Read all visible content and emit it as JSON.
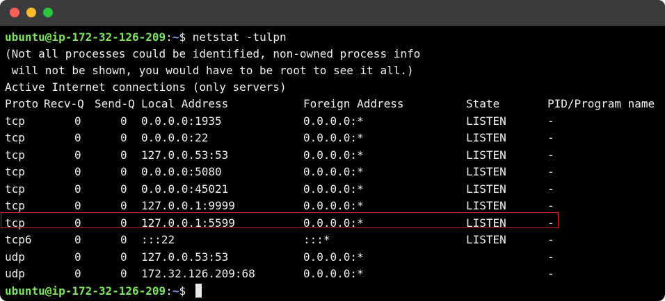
{
  "window": {
    "traffic_lights": [
      "close",
      "minimize",
      "zoom"
    ]
  },
  "prompt": {
    "user_host": "ubuntu@ip-172-32-126-209",
    "sep": ":",
    "path": "~",
    "symbol": "$ "
  },
  "command": "netstat -tulpn",
  "messages": [
    "(Not all processes could be identified, non-owned process info",
    " will not be shown, you would have to be root to see it all.)",
    "Active Internet connections (only servers)"
  ],
  "table": {
    "headers": [
      "Proto",
      "Recv-Q",
      "Send-Q",
      "Local Address",
      "Foreign Address",
      "State",
      "PID/Program name"
    ],
    "rows": [
      [
        "tcp",
        "0",
        "0",
        "0.0.0.0:1935",
        "0.0.0.0:*",
        "LISTEN",
        "-"
      ],
      [
        "tcp",
        "0",
        "0",
        "0.0.0.0:22",
        "0.0.0.0:*",
        "LISTEN",
        "-"
      ],
      [
        "tcp",
        "0",
        "0",
        "127.0.0.53:53",
        "0.0.0.0:*",
        "LISTEN",
        "-"
      ],
      [
        "tcp",
        "0",
        "0",
        "0.0.0.0:5080",
        "0.0.0.0:*",
        "LISTEN",
        "-"
      ],
      [
        "tcp",
        "0",
        "0",
        "0.0.0.0:45021",
        "0.0.0.0:*",
        "LISTEN",
        "-"
      ],
      [
        "tcp",
        "0",
        "0",
        "127.0.0.1:9999",
        "0.0.0.0:*",
        "LISTEN",
        "-"
      ],
      [
        "tcp",
        "0",
        "0",
        "127.0.0.1:5599",
        "0.0.0.0:*",
        "LISTEN",
        "-"
      ],
      [
        "tcp6",
        "0",
        "0",
        ":::22",
        ":::*",
        "LISTEN",
        "-"
      ],
      [
        "udp",
        "0",
        "0",
        "127.0.0.53:53",
        "0.0.0.0:*",
        "",
        "-"
      ],
      [
        "udp",
        "0",
        "0",
        "172.32.126.209:68",
        "0.0.0.0:*",
        "",
        "-"
      ]
    ],
    "highlighted_row_index": 6,
    "highlight_color": "#d42a2a"
  },
  "colors": {
    "user": "#7ee65a",
    "path": "#7ea8ff",
    "text": "#f0f0f0",
    "background": "#000000",
    "titlebar": "#3b3b3d"
  }
}
